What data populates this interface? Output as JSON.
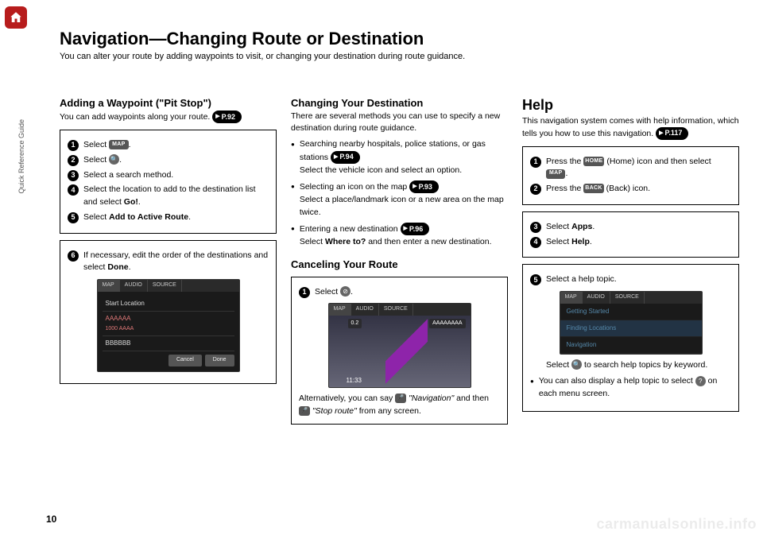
{
  "sidebar_label": "Quick Reference Guide",
  "page_number": "10",
  "title": "Navigation—Changing Route or Destination",
  "subtitle": "You can alter your route by adding waypoints to visit, or changing your destination during route guidance.",
  "col1": {
    "heading": "Adding a Waypoint (\"Pit Stop\")",
    "intro": "You can add waypoints along your route.",
    "ref": "P.92",
    "box1": {
      "s1a": "Select ",
      "s1b": ".",
      "s2a": "Select ",
      "s2b": ".",
      "s3": "Select a search method.",
      "s4a": "Select the location to add to the destination list and select ",
      "s4b": "Go!",
      "s4c": ".",
      "s5a": "Select ",
      "s5b": "Add to Active Route",
      "s5c": "."
    },
    "box2": {
      "s6a": "If necessary, edit the order of the destinations and select ",
      "s6b": "Done",
      "s6c": "."
    },
    "sc": {
      "tab1": "MAP",
      "tab2": "AUDIO",
      "tab3": "SOURCE",
      "r1": "Start Location",
      "r2a": "AAAAAA",
      "r2b": "1000 AAAA",
      "r3": "BBBBBB",
      "btn1": "Cancel",
      "btn2": "Done"
    }
  },
  "col2": {
    "heading1": "Changing Your Destination",
    "intro1": "There are several methods you can use to specify a new destination during route guidance.",
    "b1a": "Searching nearby hospitals, police stations, or gas stations ",
    "b1ref": "P.94",
    "b1b": "Select the vehicle icon and select an option.",
    "b2a": "Selecting an icon on the map ",
    "b2ref": "P.93",
    "b2b": "Select a place/landmark icon or a new area on the map twice.",
    "b3a": "Entering a new destination ",
    "b3ref": "P.96",
    "b3b": "Select ",
    "b3c": "Where to?",
    "b3d": " and then enter a new destination.",
    "heading2": "Canceling Your Route",
    "box": {
      "s1a": "Select ",
      "s1b": ".",
      "alt_a": "Alternatively, you can say ",
      "alt_nav": "\"Navigation\"",
      "alt_and": " and then ",
      "alt_stop": "\"Stop route\"",
      "alt_end": " from any screen."
    },
    "sc": {
      "tab1": "MAP",
      "tab2": "AUDIO",
      "tab3": "SOURCE",
      "dist1": "0.2",
      "dest": "AAAAAAAA",
      "time": "11:33"
    }
  },
  "col3": {
    "heading": "Help",
    "intro": "This navigation system comes with help information, which tells you how to use this navigation. ",
    "ref": "P.117",
    "box1": {
      "s1a": "Press the ",
      "s1b": " (Home) icon and then select ",
      "s1c": ".",
      "s2a": "Press the ",
      "s2b": " (Back) icon."
    },
    "box2": {
      "s3a": "Select ",
      "s3b": "Apps",
      "s3c": ".",
      "s4a": "Select ",
      "s4b": "Help",
      "s4c": "."
    },
    "box3": {
      "s5": "Select a help topic.",
      "search_a": "Select ",
      "search_b": " to search help topics by keyword.",
      "bullet_a": "You can also display a help topic to select ",
      "bullet_b": " on each menu screen."
    },
    "sc": {
      "tab1": "MAP",
      "tab2": "AUDIO",
      "tab3": "SOURCE",
      "i1": "Getting Started",
      "i2": "Finding Locations",
      "i3": "Navigation"
    }
  },
  "icons": {
    "map_chip": "MAP",
    "home_chip": "HOME",
    "back_chip": "BACK"
  },
  "watermark": "carmanualsonline.info"
}
